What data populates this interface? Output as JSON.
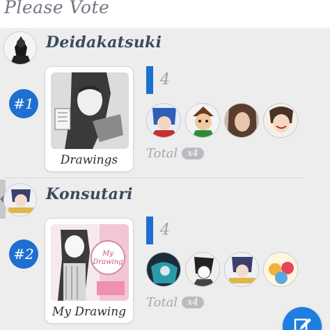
{
  "header": {
    "title": "Please Vote"
  },
  "entries": [
    {
      "username": "Deidakatsuki",
      "rank": "#1",
      "card_label": "Drawings",
      "vote_count": "4",
      "total_label": "Total",
      "total_pill": "x4",
      "voters": [
        "voter-avatar-blue-hair",
        "voter-avatar-cartoon-boy",
        "voter-avatar-photo-girl",
        "voter-avatar-smiling-anime"
      ]
    },
    {
      "username": "Konsutari",
      "rank": "#2",
      "card_label": "My Drawing",
      "card_image_text": [
        "My",
        "Drawing"
      ],
      "vote_count": "4",
      "total_label": "Total",
      "total_pill": "x4",
      "voters": [
        "voter-avatar-teal-art",
        "voter-avatar-sketch",
        "voter-avatar-dark-hair",
        "voter-avatar-colorful-group"
      ]
    }
  ],
  "colors": {
    "accent": "#1e6fd1",
    "fab": "#1e7de0",
    "background": "#ededed"
  },
  "icons": {
    "fab": "edit-icon",
    "side_tab": "chevron-left-icon"
  }
}
